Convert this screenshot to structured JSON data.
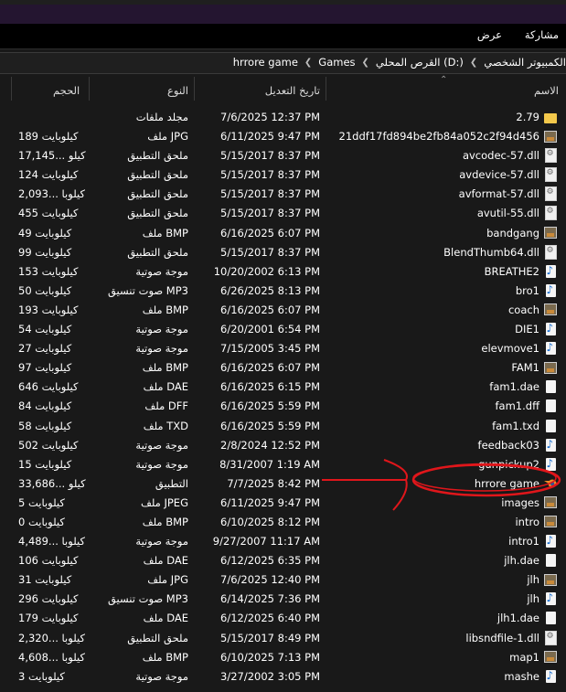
{
  "menu": {
    "share": "مشاركة",
    "view": "عرض"
  },
  "breadcrumb": [
    "الكمبيوتر الشخصي",
    "القرص المحلي (D:)",
    "Games",
    "hrrore game"
  ],
  "columns": {
    "name": "الاسم",
    "date": "تاريخ التعديل",
    "type": "النوع",
    "size": "الحجم"
  },
  "files": [
    {
      "name": "2.79",
      "date": "7/6/2025 12:37 PM",
      "type": "مجلد ملفات",
      "size": "",
      "icon": "folder-icon"
    },
    {
      "name": "21ddf17fd894be2fb84a052c2f94d456",
      "date": "6/11/2025 9:47 PM",
      "type": "ملف JPG",
      "size": "189 كيلوبايت",
      "icon": "image-file-icon"
    },
    {
      "name": "avcodec-57.dll",
      "date": "5/15/2017 8:37 PM",
      "type": "ملحق التطبيق",
      "size": "17,145... كيلو",
      "icon": "dll-file-icon"
    },
    {
      "name": "avdevice-57.dll",
      "date": "5/15/2017 8:37 PM",
      "type": "ملحق التطبيق",
      "size": "124 كيلوبايت",
      "icon": "dll-file-icon"
    },
    {
      "name": "avformat-57.dll",
      "date": "5/15/2017 8:37 PM",
      "type": "ملحق التطبيق",
      "size": "2,093... كيلوبا",
      "icon": "dll-file-icon"
    },
    {
      "name": "avutil-55.dll",
      "date": "5/15/2017 8:37 PM",
      "type": "ملحق التطبيق",
      "size": "455 كيلوبايت",
      "icon": "dll-file-icon"
    },
    {
      "name": "bandgang",
      "date": "6/16/2025 6:07 PM",
      "type": "ملف BMP",
      "size": "49 كيلوبايت",
      "icon": "image-file-icon"
    },
    {
      "name": "BlendThumb64.dll",
      "date": "5/15/2017 8:37 PM",
      "type": "ملحق التطبيق",
      "size": "99 كيلوبايت",
      "icon": "dll-file-icon"
    },
    {
      "name": "BREATHE2",
      "date": "10/20/2002 6:13 PM",
      "type": "موجة صوتية",
      "size": "153 كيلوبايت",
      "icon": "audio-file-icon"
    },
    {
      "name": "bro1",
      "date": "6/26/2025 8:13 PM",
      "type": "صوت تنسيق MP3",
      "size": "50 كيلوبايت",
      "icon": "audio-file-icon"
    },
    {
      "name": "coach",
      "date": "6/16/2025 6:07 PM",
      "type": "ملف BMP",
      "size": "193 كيلوبايت",
      "icon": "image-file-icon"
    },
    {
      "name": "DIE1",
      "date": "6/20/2001 6:54 PM",
      "type": "موجة صوتية",
      "size": "54 كيلوبايت",
      "icon": "audio-file-icon"
    },
    {
      "name": "elevmove1",
      "date": "7/15/2005 3:45 PM",
      "type": "موجة صوتية",
      "size": "27 كيلوبايت",
      "icon": "audio-file-icon"
    },
    {
      "name": "FAM1",
      "date": "6/16/2025 6:07 PM",
      "type": "ملف BMP",
      "size": "97 كيلوبايت",
      "icon": "image-file-icon"
    },
    {
      "name": "fam1.dae",
      "date": "6/16/2025 6:15 PM",
      "type": "ملف DAE",
      "size": "646 كيلوبايت",
      "icon": "file-icon"
    },
    {
      "name": "fam1.dff",
      "date": "6/16/2025 5:59 PM",
      "type": "ملف DFF",
      "size": "84 كيلوبايت",
      "icon": "file-icon"
    },
    {
      "name": "fam1.txd",
      "date": "6/16/2025 5:59 PM",
      "type": "ملف TXD",
      "size": "58 كيلوبايت",
      "icon": "file-icon"
    },
    {
      "name": "feedback03",
      "date": "2/8/2024 12:52 PM",
      "type": "موجة صوتية",
      "size": "502 كيلوبايت",
      "icon": "audio-file-icon"
    },
    {
      "name": "gunpickup2",
      "date": "8/31/2007 1:19 AM",
      "type": "موجة صوتية",
      "size": "15 كيلوبايت",
      "icon": "audio-file-icon"
    },
    {
      "name": "hrrore game",
      "date": "7/7/2025 8:42 PM",
      "type": "التطبيق",
      "size": "33,686... كيلو",
      "icon": "blender-app-icon"
    },
    {
      "name": "images",
      "date": "6/11/2025 9:47 PM",
      "type": "ملف JPEG",
      "size": "5 كيلوبايت",
      "icon": "image-file-icon"
    },
    {
      "name": "intro",
      "date": "6/10/2025 8:12 PM",
      "type": "ملف BMP",
      "size": "0 كيلوبايت",
      "icon": "image-file-icon"
    },
    {
      "name": "intro1",
      "date": "9/27/2007 11:17 AM",
      "type": "موجة صوتية",
      "size": "4,489... كيلوبا",
      "icon": "audio-file-icon"
    },
    {
      "name": "jlh.dae",
      "date": "6/12/2025 6:35 PM",
      "type": "ملف DAE",
      "size": "106 كيلوبايت",
      "icon": "file-icon"
    },
    {
      "name": "jlh",
      "date": "7/6/2025 12:40 PM",
      "type": "ملف JPG",
      "size": "31 كيلوبايت",
      "icon": "image-file-icon"
    },
    {
      "name": "jlh",
      "date": "6/14/2025 7:36 PM",
      "type": "صوت تنسيق MP3",
      "size": "296 كيلوبايت",
      "icon": "audio-file-icon"
    },
    {
      "name": "jlh1.dae",
      "date": "6/12/2025 6:40 PM",
      "type": "ملف DAE",
      "size": "179 كيلوبايت",
      "icon": "file-icon"
    },
    {
      "name": "libsndfile-1.dll",
      "date": "5/15/2017 8:49 PM",
      "type": "ملحق التطبيق",
      "size": "2,320... كيلوبا",
      "icon": "dll-file-icon"
    },
    {
      "name": "map1",
      "date": "6/10/2025 7:13 PM",
      "type": "ملف BMP",
      "size": "4,608... كيلوبا",
      "icon": "image-file-icon"
    },
    {
      "name": "mashe",
      "date": "3/27/2002 3:05 PM",
      "type": "موجة صوتية",
      "size": "3 كيلوبايت",
      "icon": "audio-file-icon"
    }
  ],
  "colors": {
    "background": "#191919",
    "annotation": "#e0161b",
    "folder": "#f3c84b",
    "audio": "#1a6fd1"
  }
}
